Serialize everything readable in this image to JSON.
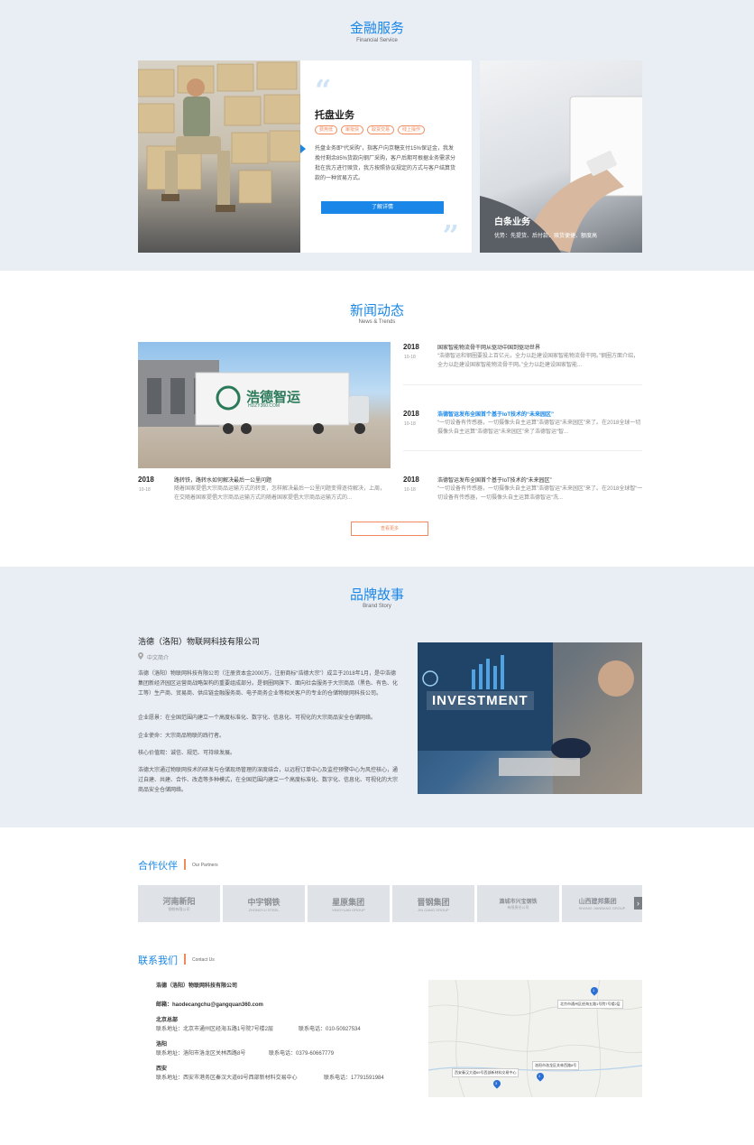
{
  "financial": {
    "title": "金融服务",
    "subtitle": "Financial Service",
    "card_title": "托盘业务",
    "tags": [
      "费用低",
      "审批快",
      "取货交易",
      "线上操作"
    ],
    "desc": "托盘业务即“代采购”，指客户向京糖支付15%保证金，我发挽付剩余85%货款向钢厂采购，客户后期可根据业务需求分批在我方进行赎货，我方按照协议规定的方式与客户结算货款的一种贸易方式。",
    "button": "了解详情",
    "right_title": "白条业务",
    "right_desc": "优势：先提货、后付款、赎货便捷、额度高"
  },
  "news": {
    "title": "新闻动态",
    "subtitle": "News & Trends",
    "truck_text": "浩德智运",
    "truck_sub": "HDZY360.COM",
    "featured": {
      "year": "2018",
      "date": "10-18",
      "title": "路转铁，路转水如何解决最后一公里问题",
      "desc": "随着国家提倡大宗商品运输方式的转变，怎样解决最后一公里问题变得逐待解决，上周，在交随着国家提倡大宗商品运输方式的随着国家提倡大宗商品运输方式的..."
    },
    "items": [
      {
        "year": "2018",
        "date": "10-18",
        "title": "国家智能物流骨干网从驱动中国到驱动世界",
        "desc": "“浩德智运和钢圈要投上百亿元，全力以赴建设国家智能物流骨干网。”钢圈方面介绍，全力以赴建设国家智能物流骨干网。”全力以赴建设国家智能..."
      },
      {
        "year": "2018",
        "date": "10-18",
        "title": "浩德智运发布全国首个基于IoT技术的“未来园区”",
        "desc": "“一切设备有传感器，一切摄像头自主运算”浩德智运“未来园区”来了。在2018全球一切摄像头自主运算”浩德智运“未来园区”来了浩德智运“智..."
      },
      {
        "year": "2018",
        "date": "10-18",
        "title": "浩德智运发布全国首个基于IoT技术的“未来园区”",
        "desc": "“一切设备有传感器，一切摄像头自主运算”浩德智运“未来园区”来了。在2018全球智“一切设备有传感器，一切摄像头自主运算浩德智运“洗..."
      }
    ],
    "more": "查看更多"
  },
  "brand": {
    "title": "品牌故事",
    "subtitle": "Brand Story",
    "company": "浩德（洛阳）物联网科技有限公司",
    "intro_label": "中文简介",
    "paragraphs": [
      "浩德（洛阳）物联网科技有限公司（注册资本金2000万，注册商标“浩德大宗”）成立于2018年1月，是中浩德集团新经济园区运营商战略架构的重要组成部分。是钢圈网旗下、面向社会服务于大宗商品（黑色、有色、化工等）生产商、贸易商、供应链金融服务商、电子商务企业等相关客户的专业的仓储物联网科技公司。",
      "企业愿景：在全国范围内建立一个高度标准化、数字化、信息化、可视化的大宗商品安全仓储网络。",
      "企业使命：大宗商品物联的践行者。",
      "核心价值观：诚信、规范、可持续发展。",
      "浩德大宗通过物联网技术的研发与仓储现场管理的深度结合，以远程订单中心及监控预警中心为风控核心，通过自建、共建、合作、改造等多种模式，在全国范围内建立一个高度标准化、数字化、信息化、可视化的大宗商品安全仓储网络。"
    ],
    "image_text": "INVESTMENT"
  },
  "partners": {
    "title": "合作伙伴",
    "subtitle": "Our Partners",
    "prev": "‹",
    "next": "›",
    "items": [
      {
        "name": "河南新阳",
        "sub": "钢铁有限公司"
      },
      {
        "name": "中宇钢铁",
        "sub": "ZHONGYU STEEL"
      },
      {
        "name": "星原集团",
        "sub": "XINGYUAN GROUP"
      },
      {
        "name": "晋钢集团",
        "sub": "JIN GANG GROUP"
      },
      {
        "name": "潞城市兴宝钢铁",
        "sub": "有限责任公司"
      },
      {
        "name": "山西建邦集团",
        "sub": "SHANXI JIANBANG GROUP"
      }
    ]
  },
  "contact": {
    "title": "联系我们",
    "subtitle": "Contact Us",
    "company": "浩德（洛阳）物联网科技有限公司",
    "email": "邮箱：haodecangchu@gangquan360.com",
    "offices": [
      {
        "city": "北京总部",
        "address": "联系地址：北京市通州区经海五路1号院7号楼2层",
        "phone": "联系电话：010-50927534"
      },
      {
        "city": "洛阳",
        "address": "联系地址：洛阳市洛龙区关林西路8号",
        "phone": "联系电话：0379-60667779"
      },
      {
        "city": "西安",
        "address": "联系地址：西安市港务区秦汉大道69号西部新材料交易中心",
        "phone": "联系电话：17791591984"
      }
    ],
    "map_labels": [
      "北京市通州区经海五路1号院7号楼2层",
      "洛阳市洛龙区关林西路8号",
      "西安秦汉大道69号西部新材料交易中心"
    ],
    "map_pins": [
      "1",
      "2",
      "3"
    ]
  },
  "colors": {
    "accent": "#1a87e8",
    "orange": "#f08a5d",
    "band": "#e9eef5"
  }
}
